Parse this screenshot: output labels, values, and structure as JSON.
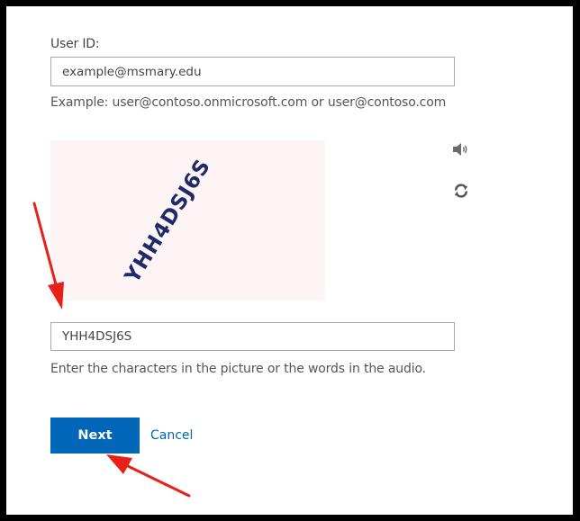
{
  "form": {
    "user_id_label": "User ID:",
    "user_id_value": "example@msmary.edu",
    "user_id_hint": "Example: user@contoso.onmicrosoft.com or user@contoso.com",
    "captcha_text": "YHH4DSJ6S",
    "captcha_input_value": "YHH4DSJ6S",
    "captcha_hint": "Enter the characters in the picture or the words in the audio.",
    "next_label": "Next",
    "cancel_label": "Cancel"
  },
  "icons": {
    "audio": "speaker-icon",
    "refresh": "refresh-icon"
  },
  "colors": {
    "primary": "#0067b8",
    "annotation_arrow": "#e8201a",
    "captcha_text": "#1f2a6b",
    "captcha_bg": "#fdf5f5"
  }
}
